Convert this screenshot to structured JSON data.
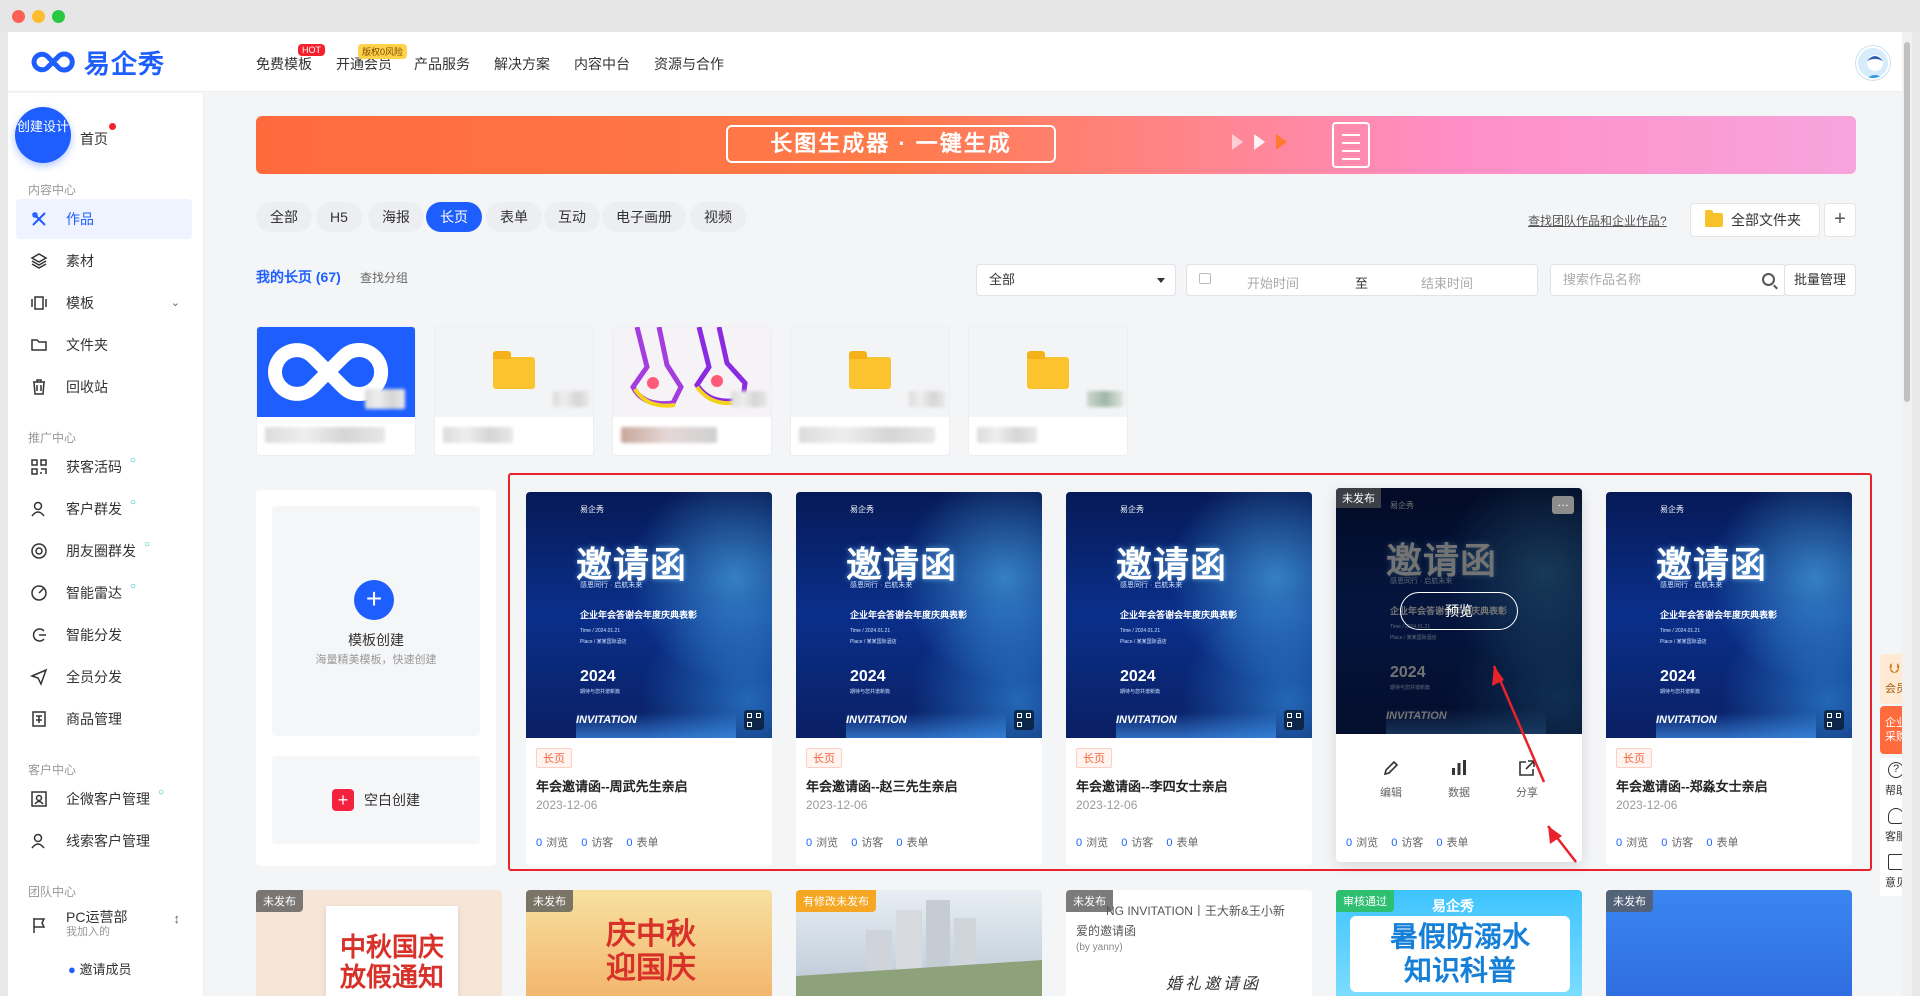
{
  "brand": {
    "name": "易企秀",
    "accent": "#1e5eff"
  },
  "nav": {
    "items": [
      {
        "label": "免费模板",
        "badge": "HOT"
      },
      {
        "label": "开通会员",
        "badge": "版权0风险"
      },
      {
        "label": "产品服务"
      },
      {
        "label": "解决方案"
      },
      {
        "label": "内容中台"
      },
      {
        "label": "资源与合作"
      }
    ]
  },
  "sidebar": {
    "create": "创建设计",
    "home": "首页",
    "sections": [
      {
        "title": "内容中心",
        "items": [
          "作品",
          "素材",
          "模板",
          "文件夹",
          "回收站"
        ]
      },
      {
        "title": "推广中心",
        "items": [
          "获客活码",
          "客户群发",
          "朋友圈群发",
          "智能雷达",
          "智能分发",
          "全员分发",
          "商品管理"
        ]
      },
      {
        "title": "客户中心",
        "items": [
          "企微客户管理",
          "线索客户管理"
        ]
      },
      {
        "title": "团队中心"
      }
    ],
    "team": {
      "name": "PC运营部",
      "sub": "我加入的",
      "invite": "邀请成员"
    }
  },
  "banner": {
    "text": "长图生成器 · 一键生成"
  },
  "tabs": [
    "全部",
    "H5",
    "海报",
    "长页",
    "表单",
    "互动",
    "电子画册",
    "视频"
  ],
  "active_tab": "长页",
  "toolbar": {
    "find_link": "查找团队作品和企业作品?",
    "all_folders": "全部文件夹",
    "mine": "我的长页 (67)",
    "find_group": "查找分组",
    "filter_value": "全部",
    "start_placeholder": "开始时间",
    "to": "至",
    "end_placeholder": "结束时间",
    "search_placeholder": "搜索作品名称",
    "batch": "批量管理"
  },
  "create_panel": {
    "template_title": "模板创建",
    "template_sub": "海量精美模板，快速创建",
    "blank": "空白创建"
  },
  "poster": {
    "logo": "易企秀",
    "headline": "邀请函",
    "tagline": "感恩同行 · 启航未来",
    "subject": "企业年会答谢会年度庆典表彰",
    "time": "Time / 2024.01.21",
    "place": "Place / 某某国际酒店",
    "year": "2024",
    "year_sub": "期待与您共谱新篇",
    "footer": "INVITATION"
  },
  "works": [
    {
      "tag": "长页",
      "title": "年会邀请函--周武先生亲启",
      "date": "2023-12-06",
      "views": "0",
      "visitors": "0",
      "forms": "0"
    },
    {
      "tag": "长页",
      "title": "年会邀请函--赵三先生亲启",
      "date": "2023-12-06",
      "views": "0",
      "visitors": "0",
      "forms": "0"
    },
    {
      "tag": "长页",
      "title": "年会邀请函--李四女士亲启",
      "date": "2023-12-06",
      "views": "0",
      "visitors": "0",
      "forms": "0"
    },
    {
      "status": "未发布",
      "preview": "预览",
      "actions": [
        "编辑",
        "数据",
        "分享"
      ],
      "views": "0",
      "visitors": "0",
      "forms": "0"
    },
    {
      "tag": "长页",
      "title": "年会邀请函--郑淼女士亲启",
      "date": "2023-12-06",
      "views": "0",
      "visitors": "0",
      "forms": "0"
    }
  ],
  "stat_labels": {
    "views": "浏览",
    "visitors": "访客",
    "forms": "表单"
  },
  "row2": [
    {
      "status": "未发布",
      "title": "中秋国庆\n放假通知",
      "color": "#f6e6d8"
    },
    {
      "status": "未发布",
      "title": "庆中秋\n迎国庆",
      "color": "#f8d38c"
    },
    {
      "status": "有修改未发布",
      "color": "#cfd9e6"
    },
    {
      "status": "未发布",
      "text": "NG INVITATION丨王大新&王小新",
      "text2": "爱的邀请函",
      "text3": "(by yanny)",
      "text4": "婚礼邀请函",
      "color": "#ffffff"
    },
    {
      "status": "审核通过",
      "logo": "易企秀",
      "title": "暑假防溺水\n知识科普",
      "color": "#45c7ff"
    },
    {
      "status": "未发布",
      "color": "#3a86f0"
    }
  ],
  "rightbar": [
    "会员",
    "企业采购",
    "帮助",
    "客服",
    "意见"
  ]
}
